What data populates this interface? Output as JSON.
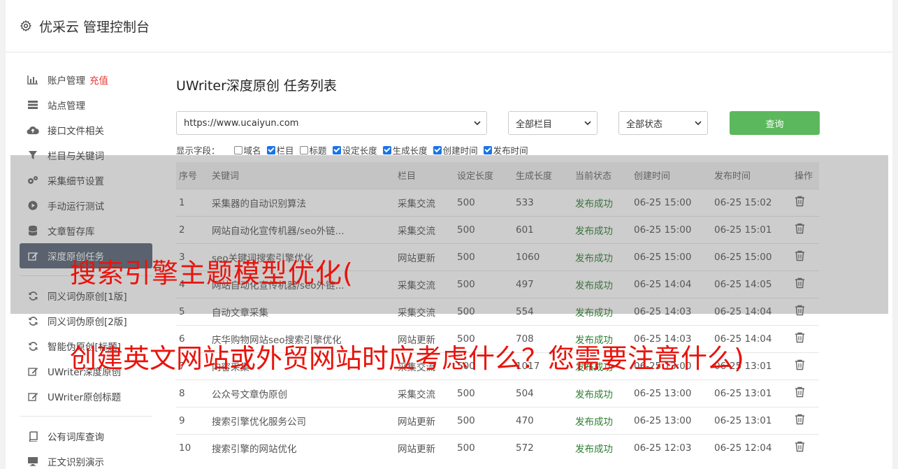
{
  "app": {
    "title": "优采云 管理控制台",
    "icon": "gear-icon"
  },
  "sidebar": {
    "items": [
      {
        "label": "账户管理",
        "badge": "充值",
        "icon": "bar-chart-icon"
      },
      {
        "label": "站点管理",
        "icon": "server-icon"
      },
      {
        "label": "接口文件相关",
        "icon": "cloud-upload-icon"
      },
      {
        "label": "栏目与关键词",
        "icon": "filter-icon"
      },
      {
        "label": "采集细节设置",
        "icon": "gears-icon"
      },
      {
        "label": "手动运行测试",
        "icon": "play-icon"
      },
      {
        "label": "文章暂存库",
        "icon": "database-icon"
      },
      {
        "label": "深度原创任务",
        "icon": "edit-icon",
        "active": true
      },
      {
        "label": "同义词伪原创[1版]",
        "icon": "refresh-icon"
      },
      {
        "label": "同义词伪原创[2版]",
        "icon": "refresh-icon"
      },
      {
        "label": "智能伪原创[标题]",
        "icon": "refresh-icon"
      },
      {
        "label": "UWriter深度原创",
        "icon": "edit-icon"
      },
      {
        "label": "UWriter原创标题",
        "icon": "edit-icon"
      },
      {
        "label": "公有词库查询",
        "icon": "book-icon"
      },
      {
        "label": "正文识别演示",
        "icon": "monitor-icon"
      }
    ]
  },
  "main": {
    "title": "UWriter深度原创 任务列表",
    "site_select": "https://www.ucaiyun.com",
    "column_select": "全部栏目",
    "status_select": "全部状态",
    "query_button": "查询",
    "fields_label": "显示字段：",
    "fields": [
      {
        "label": "域名",
        "checked": false
      },
      {
        "label": "栏目",
        "checked": true
      },
      {
        "label": "标题",
        "checked": false
      },
      {
        "label": "设定长度",
        "checked": true
      },
      {
        "label": "生成长度",
        "checked": true
      },
      {
        "label": "创建时间",
        "checked": true
      },
      {
        "label": "发布时间",
        "checked": true
      }
    ],
    "table": {
      "headers": [
        "序号",
        "关键词",
        "栏目",
        "设定长度",
        "生成长度",
        "当前状态",
        "创建时间",
        "发布时间",
        "操作"
      ],
      "rows": [
        [
          "1",
          "采集器的自动识别算法",
          "采集交流",
          "500",
          "533",
          "发布成功",
          "06-25 15:00",
          "06-25 15:02"
        ],
        [
          "2",
          "网站自动化宣传机器/seo外链...",
          "采集交流",
          "500",
          "601",
          "发布成功",
          "06-25 15:00",
          "06-25 15:01"
        ],
        [
          "3",
          "seo关键词搜索引擎优化",
          "网站更新",
          "500",
          "1060",
          "发布成功",
          "06-25 15:00",
          "06-25 15:00"
        ],
        [
          "4",
          "网站自动化宣传机器/seo外链...",
          "采集交流",
          "500",
          "497",
          "发布成功",
          "06-25 14:04",
          "06-25 14:05"
        ],
        [
          "5",
          "自动文章采集",
          "采集交流",
          "500",
          "554",
          "发布成功",
          "06-25 14:03",
          "06-25 14:04"
        ],
        [
          "6",
          "庆华购物网站seo搜索引擎优化",
          "网站更新",
          "500",
          "708",
          "发布成功",
          "06-25 14:03",
          "06-25 14:04"
        ],
        [
          "7",
          "内容采集",
          "采集交流",
          "500",
          "1017",
          "发布成功",
          "06-25 13:00",
          "06-25 13:01"
        ],
        [
          "8",
          "公众号文章伪原创",
          "采集交流",
          "500",
          "504",
          "发布成功",
          "06-25 13:00",
          "06-25 13:01"
        ],
        [
          "9",
          "搜索引擎优化服务公司",
          "网站更新",
          "500",
          "470",
          "发布成功",
          "06-25 13:00",
          "06-25 13:01"
        ],
        [
          "10",
          "搜索引擎的网站优化",
          "网站更新",
          "500",
          "572",
          "发布成功",
          "06-25 12:03",
          "06-25 12:04"
        ]
      ]
    }
  },
  "overlay": {
    "line1": "搜索引擎主题模型优化(",
    "line2": "创建英文网站或外贸网站时应考虑什么？您需要注意什么)"
  },
  "colors": {
    "active_nav": "#5a6677",
    "query_button": "#5cb85c",
    "status_ok": "#2e7d32",
    "badge": "#e53935",
    "overlay_text": "#e8140c"
  }
}
